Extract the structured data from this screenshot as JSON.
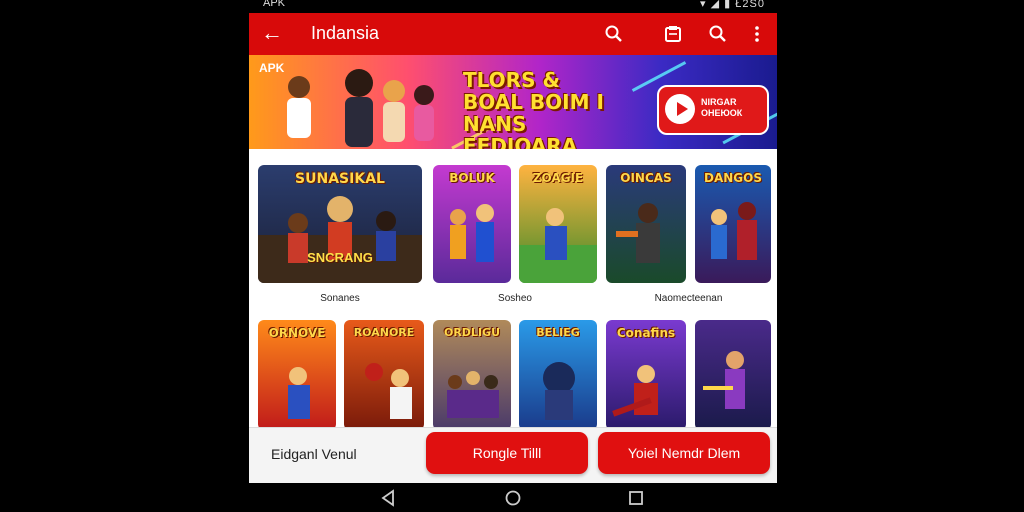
{
  "status_bar": {
    "left": "APK",
    "right": "Ł2S0"
  },
  "app_bar": {
    "title": "Indansia",
    "icons": [
      "back-arrow-icon",
      "search-icon",
      "clipboard-icon",
      "search-icon",
      "more-vert-icon"
    ]
  },
  "banner": {
    "tag": "APK",
    "headline": "TLORS & BOAL BOIM I NANS FEDIOARA",
    "play_label": "NIRGAR ОНЕЮОК",
    "colors": {
      "play_button": "#e01919",
      "accent": "#ffe030"
    }
  },
  "row1": [
    {
      "title": "SUNASIKAL",
      "subtitle": "SNCRANG"
    },
    {
      "title": "BOLUK",
      "subtitle": ""
    },
    {
      "title": "ZOAGIE",
      "subtitle": ""
    },
    {
      "title": "OINCAS",
      "subtitle": ""
    },
    {
      "title": "DANGOS",
      "subtitle": ""
    }
  ],
  "row1_captions": [
    "Sonanes",
    "Sosheo",
    "Naomecteenan"
  ],
  "row2": [
    {
      "title": "ORNOVE"
    },
    {
      "title": "ROANORE"
    },
    {
      "title": "ORDLIGU"
    },
    {
      "title": "BELIEG"
    },
    {
      "title": "Conafins"
    },
    {
      "title": ""
    }
  ],
  "bottom_bar": {
    "label": "Eidganl Venul",
    "button1": "Rongle Tilll",
    "button2": "Yoiel Nemdr Dlem"
  },
  "nav_bar": {
    "icons": [
      "back-triangle-icon",
      "home-circle-icon",
      "recents-square-icon"
    ]
  },
  "theme": {
    "primary": "#d80a0a",
    "background": "#ffffff"
  }
}
